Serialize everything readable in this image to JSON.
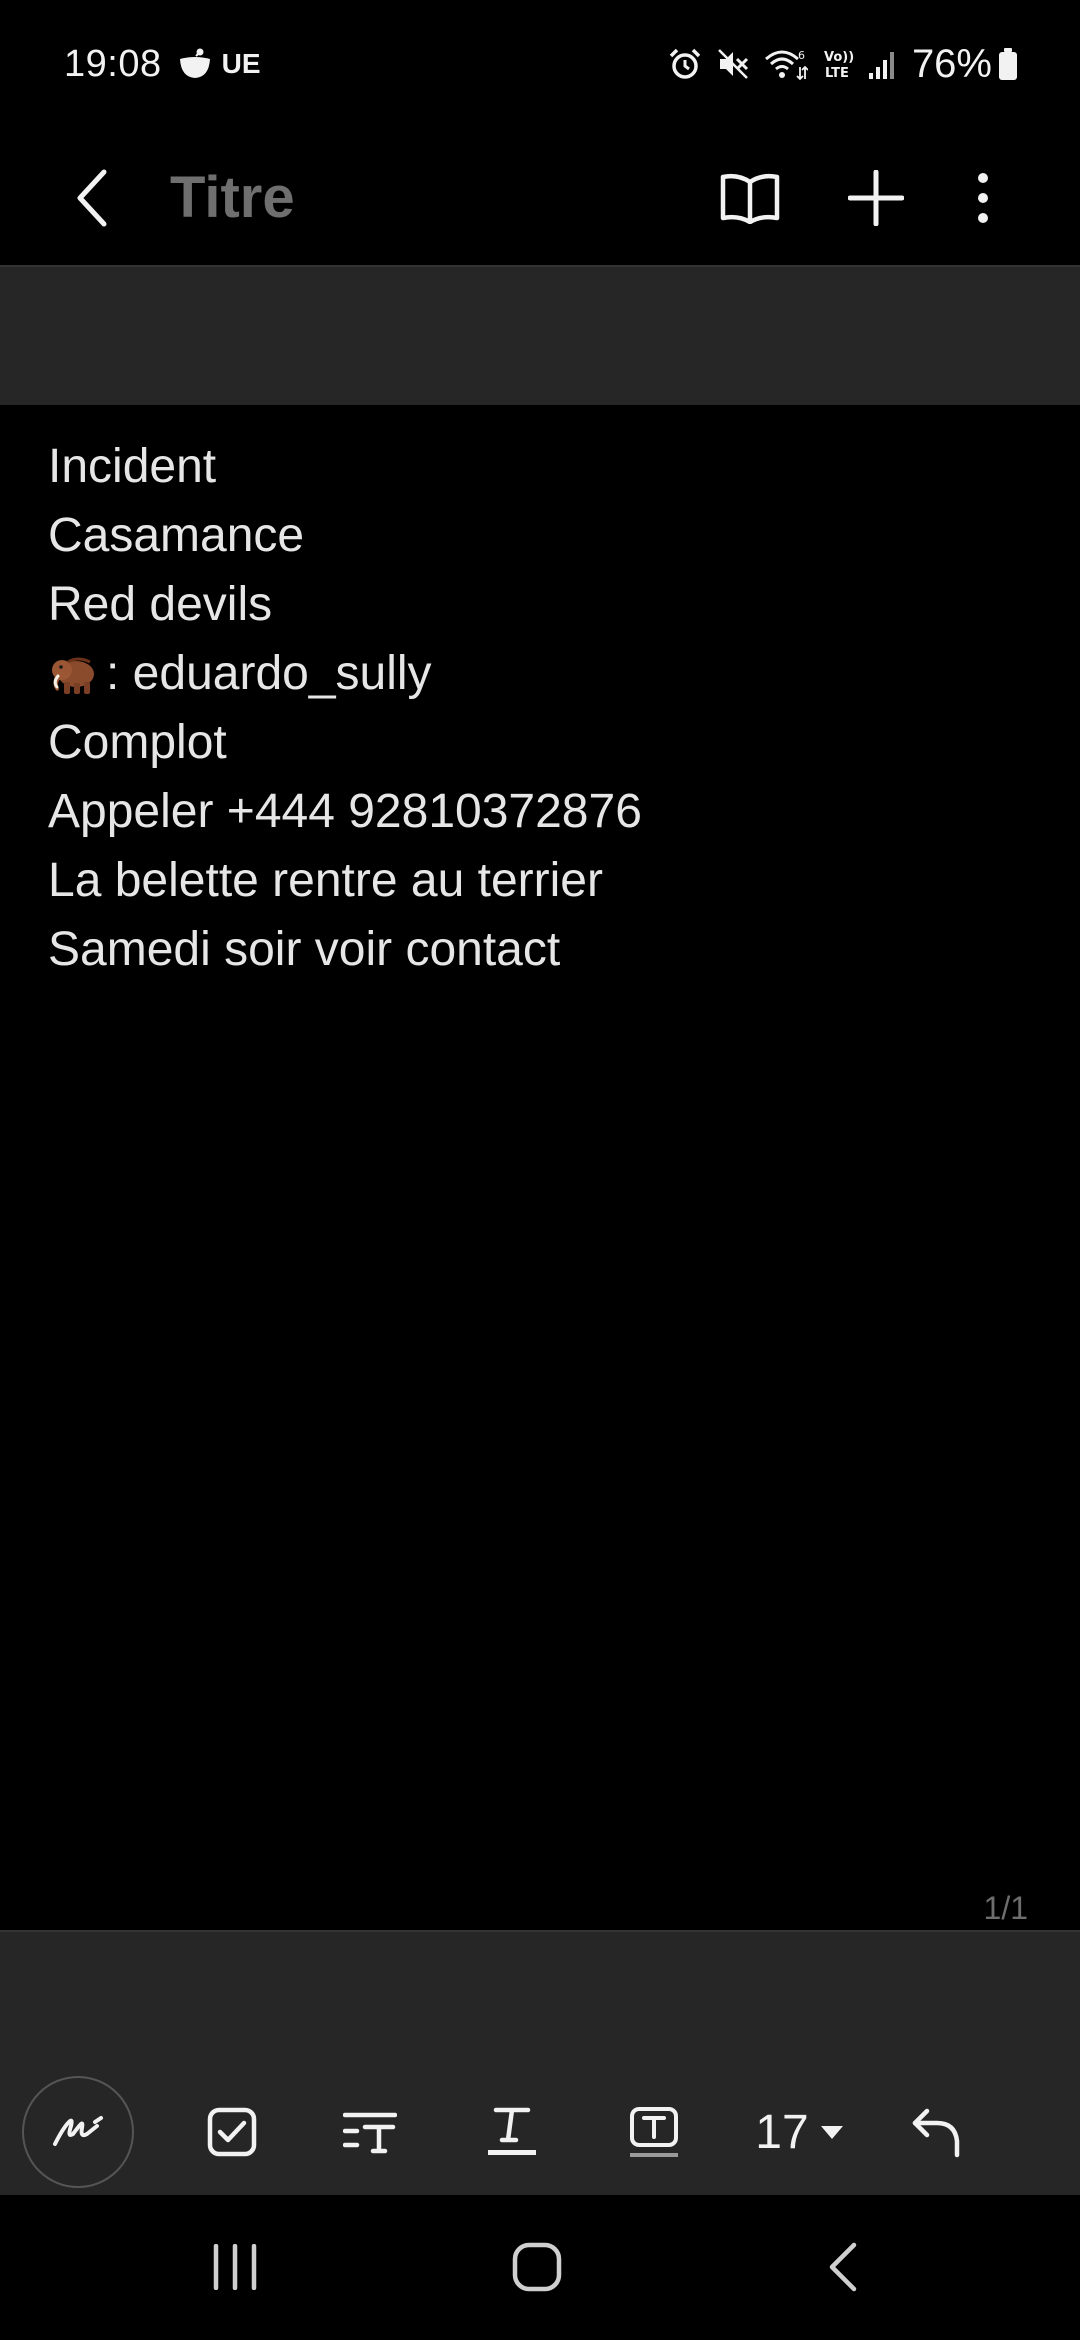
{
  "status_bar": {
    "time": "19:08",
    "carrier": "UE",
    "battery": "76%",
    "icons": [
      "alarm-icon",
      "mute-icon",
      "wifi-icon",
      "volte-icon",
      "signal-icon",
      "battery-icon"
    ]
  },
  "app_bar": {
    "title": "Titre",
    "icons": [
      "back-icon",
      "reading-mode-icon",
      "add-icon",
      "more-options-icon"
    ]
  },
  "note": {
    "lines": [
      "Incident",
      "Casamance",
      "Red devils",
      ":  eduardo_sully",
      "Complot",
      "Appeler +444 92810372876",
      "La belette rentre au terrier",
      "Samedi soir voir contact"
    ],
    "emoji_line_index": 3,
    "emoji": "mammoth-icon",
    "page_counter": "1/1"
  },
  "toolbar": {
    "font_size": "17",
    "icons": [
      "handwriting-pen-icon",
      "checkbox-icon",
      "text-style-icon",
      "text-color-icon",
      "text-box-icon",
      "font-size-dropdown-icon",
      "undo-icon"
    ]
  },
  "nav_bar": {
    "icons": [
      "recent-apps-icon",
      "home-icon",
      "back-nav-icon"
    ]
  },
  "colors": {
    "background": "#000000",
    "panel": "#262626",
    "text": "#e6e6e6",
    "title_placeholder": "#6f6f6f"
  }
}
